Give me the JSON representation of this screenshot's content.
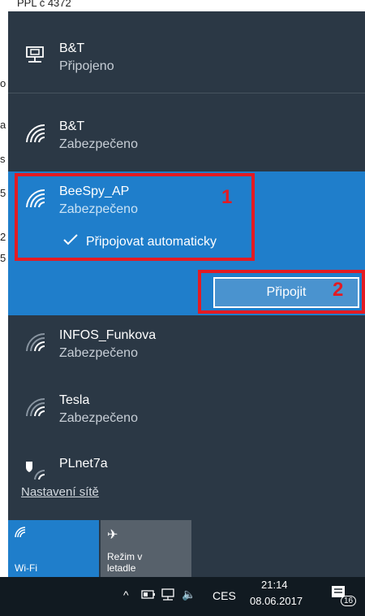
{
  "background_fragments": [
    "PPL č 4372",
    "o",
    "a",
    "s",
    "5",
    "2",
    "5"
  ],
  "networks": [
    {
      "name": "B&T",
      "status": "Připojeno",
      "icon": "ethernet-icon"
    },
    {
      "name": "B&T",
      "status": "Zabezpečeno",
      "icon": "wifi-icon"
    },
    {
      "name": "BeeSpy_AP",
      "status": "Zabezpečeno",
      "icon": "wifi-icon"
    },
    {
      "name": "INFOS_Funkova",
      "status": "Zabezpečeno",
      "icon": "wifi-icon"
    },
    {
      "name": "Tesla",
      "status": "Zabezpečeno",
      "icon": "wifi-icon"
    },
    {
      "name": "PLnet7a",
      "status": "",
      "icon": "wifi-shield-icon"
    }
  ],
  "auto_connect": {
    "label": "Připojovat automaticky",
    "checked": true
  },
  "connect_button": "Připojit",
  "annotations": [
    "1",
    "2"
  ],
  "settings_link": "Nastavení sítě",
  "quick_actions": [
    {
      "label": "Wi-Fi",
      "icon": "wifi-icon",
      "active": true,
      "color": "#1f7ecb"
    },
    {
      "label": "Režim v letadle",
      "icon": "airplane-icon",
      "active": false,
      "color": "#57616b"
    }
  ],
  "taskbar": {
    "language": "CES",
    "time": "21:14",
    "date": "08.06.2017",
    "notifications": "16",
    "icons": [
      "chevron-up-icon",
      "battery-icon",
      "network-icon",
      "volume-icon",
      "action-center-icon"
    ]
  }
}
